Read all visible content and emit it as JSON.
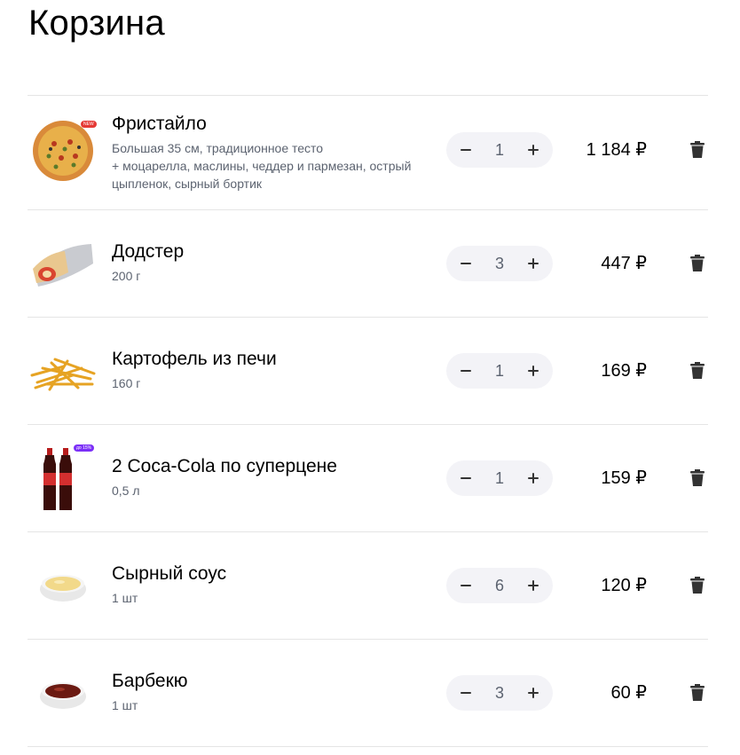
{
  "page": {
    "title": "Корзина"
  },
  "colors": {
    "stepper_bg": "#f3f3f7",
    "muted_text": "#5c6370",
    "divider": "#e5e5e5",
    "icon": "#333333"
  },
  "items": [
    {
      "name": "Фристайло",
      "desc_lines": [
        "Большая 35 см, традиционное тесто",
        "+ моцарелла, маслины, чеддер и пармезан, острый",
        "цыпленок, сырный бортик"
      ],
      "qty": "1",
      "price": "1 184 ₽",
      "badge": "NEW",
      "icon": "pizza-image"
    },
    {
      "name": "Додстер",
      "desc_lines": [
        "200 г"
      ],
      "qty": "3",
      "price": "447 ₽",
      "icon": "dodster-image"
    },
    {
      "name": "Картофель из печи",
      "desc_lines": [
        "160 г"
      ],
      "qty": "1",
      "price": "169 ₽",
      "icon": "fries-image"
    },
    {
      "name": "2 Coca-Cola по суперцене",
      "desc_lines": [
        "0,5 л"
      ],
      "qty": "1",
      "price": "159 ₽",
      "badge": "до 15%",
      "icon": "cola-image"
    },
    {
      "name": "Сырный соус",
      "desc_lines": [
        "1 шт"
      ],
      "qty": "6",
      "price": "120 ₽",
      "icon": "cheese-sauce-image"
    },
    {
      "name": "Барбекю",
      "desc_lines": [
        "1 шт"
      ],
      "qty": "3",
      "price": "60 ₽",
      "icon": "bbq-sauce-image"
    }
  ]
}
